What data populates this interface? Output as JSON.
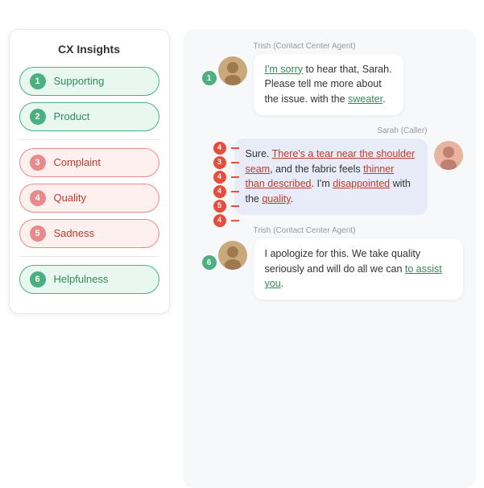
{
  "leftPanel": {
    "title": "CX Insights",
    "items": [
      {
        "id": 1,
        "label": "Supporting",
        "type": "green"
      },
      {
        "id": 2,
        "label": "Product",
        "type": "green"
      },
      {
        "id": 3,
        "label": "Complaint",
        "type": "red"
      },
      {
        "id": 4,
        "label": "Quality",
        "type": "red"
      },
      {
        "id": 5,
        "label": "Sadness",
        "type": "red"
      },
      {
        "id": 6,
        "label": "Helpfulness",
        "type": "green"
      }
    ]
  },
  "chat": {
    "messages": [
      {
        "id": "msg1",
        "sender": "agent",
        "senderLabel": "Trish (Contact Center Agent)",
        "lines": [
          {
            "text": "I'm sorry",
            "style": "underline-green"
          },
          {
            "text": " to hear that, Sarah."
          },
          {
            "text": "Please tell me more about"
          },
          {
            "text": "the issue. with the "
          },
          {
            "text": "sweater",
            "style": "underline-green"
          },
          {
            "text": "."
          }
        ],
        "indicators": [
          {
            "num": 1,
            "type": "green"
          }
        ]
      },
      {
        "id": "msg2",
        "sender": "caller",
        "senderLabel": "Sarah (Caller)",
        "lines": [
          {
            "text": "Sure. "
          },
          {
            "text": "There's a tear near the shoulder seam",
            "style": "underline-red"
          },
          {
            "text": ", and the fabric feels "
          },
          {
            "text": "thinner than described",
            "style": "underline-red"
          },
          {
            "text": ". I'm "
          },
          {
            "text": "disappointed",
            "style": "underline-red"
          },
          {
            "text": " with the "
          },
          {
            "text": "quality",
            "style": "underline-red"
          },
          {
            "text": "."
          }
        ],
        "indicators": [
          {
            "num": 4,
            "type": "red"
          },
          {
            "num": 3,
            "type": "red"
          },
          {
            "num": 4,
            "type": "red"
          },
          {
            "num": 4,
            "type": "red"
          },
          {
            "num": 5,
            "type": "red"
          },
          {
            "num": 4,
            "type": "red"
          }
        ]
      },
      {
        "id": "msg3",
        "sender": "agent",
        "senderLabel": "Trish (Contact Center Agent)",
        "lines": [
          {
            "text": "I apologize for this. We take quality seriously and will do all we can "
          },
          {
            "text": "to assist you",
            "style": "underline-green"
          },
          {
            "text": "."
          }
        ],
        "indicators": [
          {
            "num": 6,
            "type": "green"
          }
        ]
      }
    ]
  }
}
